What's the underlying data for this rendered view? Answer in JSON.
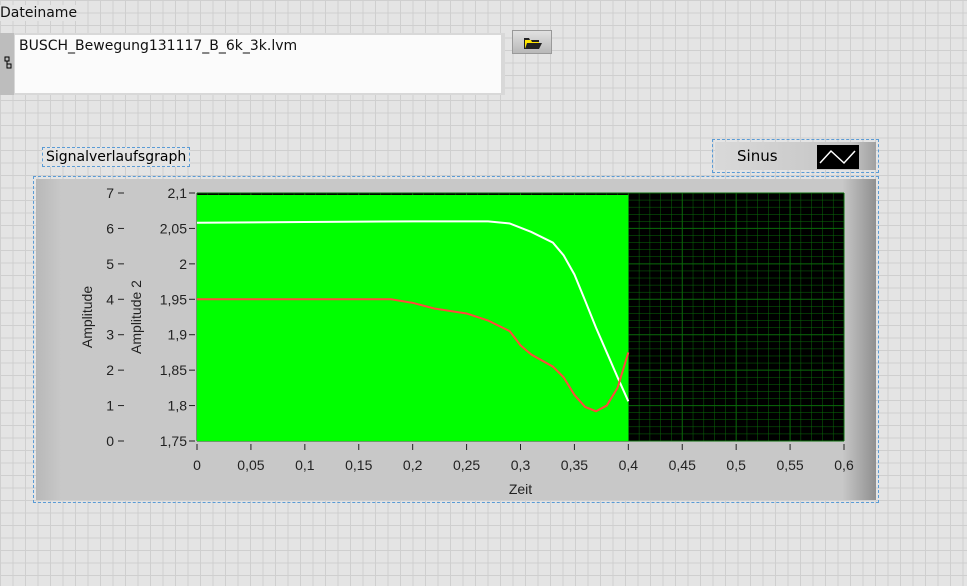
{
  "file_control": {
    "label": "Dateiname",
    "value": "BUSCH_Bewegung131117_B_6k_3k.lvm",
    "browse_icon": "folder-open-icon"
  },
  "graph": {
    "label": "Signalverlaufsgraph",
    "legend": {
      "plot_name": "Sinus",
      "plot_icon": "sine-line-icon"
    }
  },
  "chart_data": {
    "type": "line",
    "title": "Signalverlaufsgraph",
    "xlabel": "Zeit",
    "ylabel": "Amplitude",
    "ylabel2": "Amplitude 2",
    "xlim": [
      0,
      0.6
    ],
    "ylim": [
      0,
      7
    ],
    "ylim2": [
      1.75,
      2.1
    ],
    "xticks": [
      "0",
      "0,05",
      "0,1",
      "0,15",
      "0,2",
      "0,25",
      "0,3",
      "0,35",
      "0,4",
      "0,45",
      "0,5",
      "0,55",
      "0,6"
    ],
    "yticks": [
      "0",
      "1",
      "2",
      "3",
      "4",
      "5",
      "6",
      "7"
    ],
    "yticks2": [
      "1,75",
      "1,8",
      "1,85",
      "1,9",
      "1,95",
      "2",
      "2,05",
      "2,1"
    ],
    "grid": true,
    "legend_position": "top-right",
    "colors": {
      "plot_bg": "#000000",
      "grid": "#0a6b0a",
      "fill": "#00ff00",
      "white": "#ffffff",
      "red": "#ff4a3a"
    },
    "series": [
      {
        "name": "Sinus",
        "axis": "left",
        "color": "#00ff00",
        "fill": true,
        "x": [
          0,
          0.4
        ],
        "y": [
          7,
          7
        ]
      },
      {
        "name": "white",
        "axis": "right",
        "color": "#ffffff",
        "x": [
          0,
          0.1,
          0.2,
          0.27,
          0.29,
          0.31,
          0.33,
          0.34,
          0.35,
          0.36,
          0.37,
          0.38,
          0.39,
          0.4
        ],
        "y": [
          2.058,
          2.059,
          2.06,
          2.06,
          2.057,
          2.045,
          2.03,
          2.012,
          1.985,
          1.948,
          1.91,
          1.875,
          1.84,
          1.806
        ]
      },
      {
        "name": "red",
        "axis": "right",
        "color": "#ff4a3a",
        "x": [
          0,
          0.1,
          0.18,
          0.2,
          0.22,
          0.25,
          0.27,
          0.29,
          0.3,
          0.31,
          0.33,
          0.34,
          0.35,
          0.36,
          0.37,
          0.38,
          0.39,
          0.4
        ],
        "y": [
          1.95,
          1.95,
          1.95,
          1.945,
          1.937,
          1.93,
          1.92,
          1.905,
          1.885,
          1.872,
          1.855,
          1.84,
          1.815,
          1.798,
          1.792,
          1.8,
          1.825,
          1.875
        ]
      }
    ]
  }
}
